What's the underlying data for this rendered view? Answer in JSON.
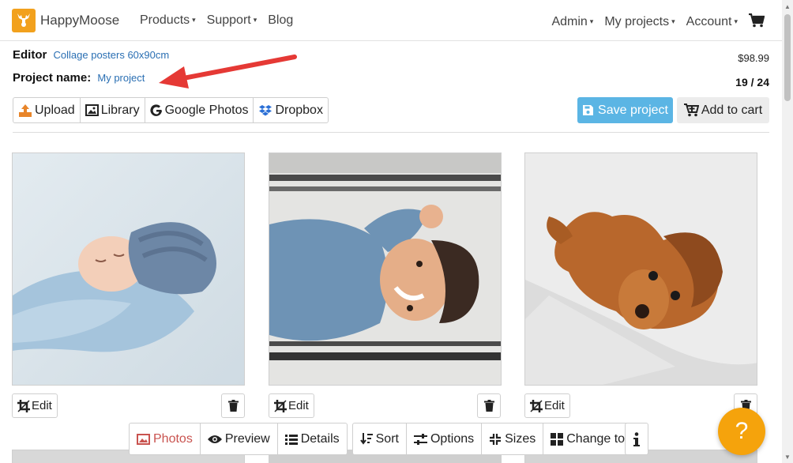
{
  "brand": {
    "name": "HappyMoose",
    "color": "#f2a11d"
  },
  "nav": {
    "left": [
      {
        "label": "Products",
        "caret": "▾"
      },
      {
        "label": "Support",
        "caret": "▾"
      },
      {
        "label": "Blog",
        "caret": ""
      }
    ],
    "right": [
      {
        "label": "Admin",
        "caret": "▾"
      },
      {
        "label": "My projects",
        "caret": "▾"
      },
      {
        "label": "Account",
        "caret": "▾"
      }
    ],
    "cart_icon": "shopping-cart-icon"
  },
  "editor": {
    "label": "Editor",
    "product_link": "Collage posters 60x90cm",
    "project_label": "Project name:",
    "project_name": "My project",
    "price": "$98.99",
    "photo_count": "19 / 24"
  },
  "sources": [
    {
      "label": "Upload",
      "icon": "upload-icon"
    },
    {
      "label": "Library",
      "icon": "image-icon"
    },
    {
      "label": "Google Photos",
      "icon": "google-icon"
    },
    {
      "label": "Dropbox",
      "icon": "dropbox-icon"
    }
  ],
  "actions": {
    "save_label": "Save project",
    "save_color": "#5bb5e4",
    "cart_label": "Add to cart"
  },
  "photos": [
    {
      "subject": "sleeping baby in blue knit hat",
      "edit_label": "Edit"
    },
    {
      "subject": "smiling toddler in denim shirt",
      "edit_label": "Edit"
    },
    {
      "subject": "brown spaniel puppy",
      "edit_label": "Edit"
    }
  ],
  "toolbar": [
    {
      "label": "Photos",
      "icon": "image-icon",
      "active": true
    },
    {
      "label": "Preview",
      "icon": "eye-icon",
      "active": false
    },
    {
      "label": "Details",
      "icon": "list-icon",
      "active": false
    },
    {
      "label": "Sort",
      "icon": "sort-icon",
      "active": false
    },
    {
      "label": "Options",
      "icon": "sliders-icon",
      "active": false
    },
    {
      "label": "Sizes",
      "icon": "compress-icon",
      "active": false
    },
    {
      "label": "Change to",
      "icon": "grid-icon",
      "active": false
    }
  ],
  "toolbar_active_color": "#c9534f",
  "info_icon": "info-icon",
  "help": {
    "label": "?",
    "color": "#f5a30c"
  },
  "annotation_color": "#e53935"
}
